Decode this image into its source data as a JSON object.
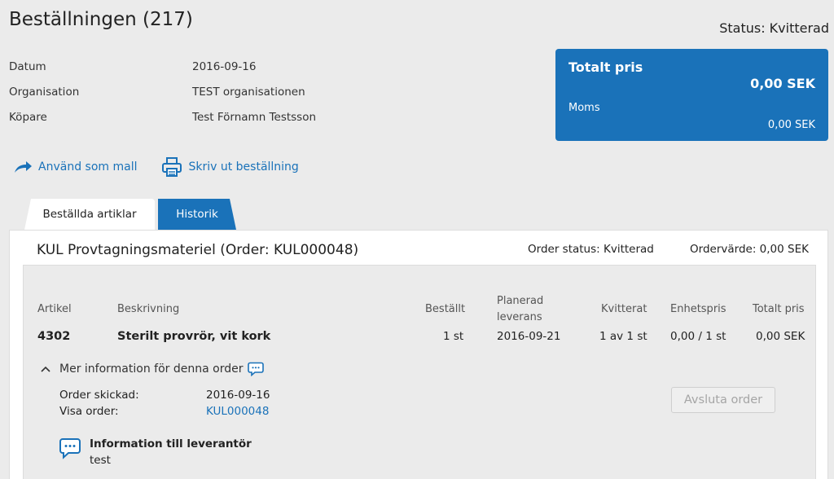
{
  "header": {
    "title": "Beställningen (217)",
    "status": "Status: Kvitterad"
  },
  "meta": [
    {
      "label": "Datum",
      "value": "2016-09-16"
    },
    {
      "label": "Organisation",
      "value": "TEST organisationen"
    },
    {
      "label": "Köpare",
      "value": "Test Förnamn Testsson"
    }
  ],
  "price": {
    "title": "Totalt pris",
    "total": "0,00 SEK",
    "vat_label": "Moms",
    "vat_value": "0,00 SEK"
  },
  "actions": {
    "use_template": "Använd som mall",
    "print": "Skriv ut beställning"
  },
  "tabs": [
    {
      "label": "Beställda artiklar",
      "active": true
    },
    {
      "label": "Historik",
      "active": false
    }
  ],
  "order": {
    "title": "KUL Provtagningsmateriel (Order: KUL000048)",
    "status": "Order status: Kvitterad",
    "value": "Ordervärde: 0,00 SEK",
    "columns": {
      "article": "Artikel",
      "description": "Beskrivning",
      "ordered": "Beställt",
      "planned_line1": "Planerad",
      "planned_line2": "leverans",
      "receipted": "Kvitterat",
      "unit_price": "Enhetspris",
      "total_price": "Totalt pris"
    },
    "row": {
      "article": "4302",
      "description": "Sterilt provrör, vit kork",
      "ordered": "1 st",
      "planned": "2016-09-21",
      "receipted": "1 av 1 st",
      "unit_price": "0,00 / 1 st",
      "total_price": "0,00 SEK"
    },
    "more_info": "Mer information för denna order",
    "sent_label": "Order skickad:",
    "sent_value": "2016-09-16",
    "view_label": "Visa order:",
    "view_value": "KUL000048",
    "close_button": "Avsluta order",
    "supplier_title": "Information till leverantör",
    "supplier_text": "test"
  },
  "colors": {
    "accent": "#1a72b9",
    "background": "#ebebeb"
  },
  "icons": [
    "share-arrow-icon",
    "printer-icon",
    "chevron-up-icon",
    "chat-bubble-icon"
  ]
}
